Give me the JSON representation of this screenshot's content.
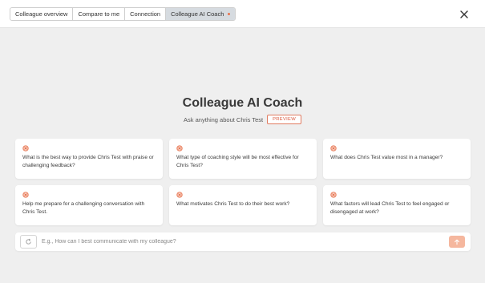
{
  "tabs": [
    {
      "label": "Colleague overview",
      "active": false
    },
    {
      "label": "Compare to me",
      "active": false
    },
    {
      "label": "Connection",
      "active": false
    },
    {
      "label": "Colleague AI Coach",
      "active": true,
      "indicator": "dot"
    }
  ],
  "header": {
    "close_icon": "close-icon"
  },
  "main": {
    "title": "Colleague AI Coach",
    "subtitle": "Ask anything about Chris Test",
    "badge": "PREVIEW"
  },
  "suggestions": [
    {
      "icon": "sparkle-icon",
      "text": "What is the best way to provide Chris Test with praise or challenging feedback?"
    },
    {
      "icon": "sparkle-icon",
      "text": "What type of coaching style will be most effective for Chris Test?"
    },
    {
      "icon": "sparkle-icon",
      "text": "What does Chris Test value most in a manager?"
    },
    {
      "icon": "sparkle-icon",
      "text": "Help me prepare for a challenging conversation with Chris Test."
    },
    {
      "icon": "sparkle-icon",
      "text": "What motivates Chris Test to do their best work?"
    },
    {
      "icon": "sparkle-icon",
      "text": "What factors will lead Chris Test to feel engaged or disengaged at work?"
    }
  ],
  "chat": {
    "placeholder": "E.g., How can I best communicate with my colleague?",
    "value": "",
    "refresh_icon": "refresh-icon",
    "send_icon": "arrow-up-icon"
  },
  "colors": {
    "accent": "#e8744f",
    "send_bg": "#f5b79e",
    "active_tab": "#d6dbe0",
    "page_bg": "#efefef"
  }
}
